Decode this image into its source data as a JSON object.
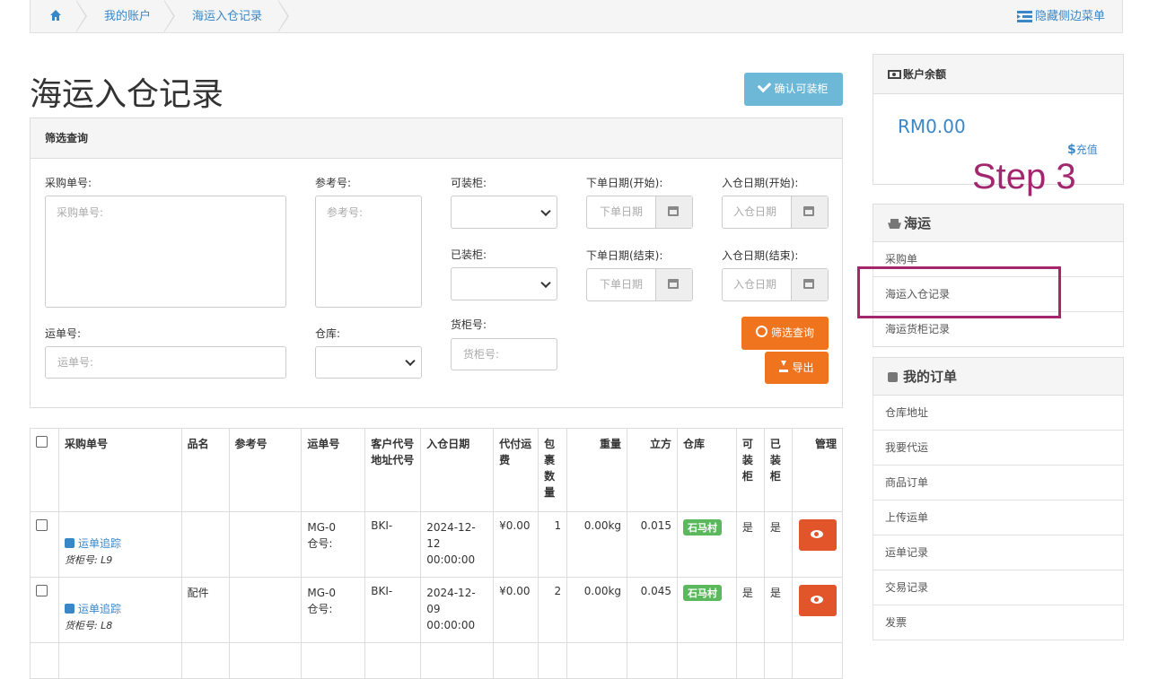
{
  "breadcrumb": {
    "home_icon": "home-icon",
    "items": [
      "我的账户",
      "海运入仓记录"
    ],
    "toggle_label": "隐藏侧边菜单",
    "toggle_icon": "menu-toggle-icon"
  },
  "page": {
    "title": "海运入仓记录",
    "confirm_button": "确认可装柜"
  },
  "filter": {
    "title": "筛选查询",
    "fields": {
      "po_label": "采购单号:",
      "po_placeholder": "采购单号:",
      "ref_label": "参考号:",
      "ref_placeholder": "参考号:",
      "loadable_label": "可装柜:",
      "loaded_label": "已装柜:",
      "order_start_label": "下单日期(开始):",
      "order_start_placeholder": "下单日期",
      "order_end_label": "下单日期(结束):",
      "order_end_placeholder": "下单日期",
      "in_start_label": "入仓日期(开始):",
      "in_start_placeholder": "入仓日期",
      "in_end_label": "入仓日期(结束):",
      "in_end_placeholder": "入仓日期",
      "waybill_label": "运单号:",
      "waybill_placeholder": "运单号:",
      "warehouse_label": "仓库:",
      "container_label": "货柜号:",
      "container_placeholder": "货柜号:"
    },
    "search_button": "筛选查询",
    "export_button": "导出"
  },
  "table": {
    "headers": [
      "采购单号",
      "品名",
      "参考号",
      "运单号",
      "客户代号\n地址代号",
      "入仓日期",
      "代付运费",
      "包裹数量",
      "重量",
      "立方",
      "仓库",
      "可装柜",
      "已装柜",
      "管理"
    ],
    "rows": [
      {
        "track": "运单追踪",
        "container": "货柜号:  L9",
        "name": "",
        "ref": "",
        "waybill": "MG-0\n仓号:",
        "customer": "BKI-",
        "date": "2024-12-12\n00:00:00",
        "freight": "¥0.00",
        "packages": "1",
        "weight": "0.00kg",
        "volume": "0.015",
        "warehouse": "石马村",
        "loadable": "是",
        "loaded": "是"
      },
      {
        "track": "运单追踪",
        "container": "货柜号:  L8",
        "name": "配件",
        "ref": "",
        "waybill": "MG-0\n仓号:",
        "customer": "BKI-",
        "date": "2024-12-09\n00:00:00",
        "freight": "¥0.00",
        "packages": "2",
        "weight": "0.00kg",
        "volume": "0.045",
        "warehouse": "石马村",
        "loadable": "是",
        "loaded": "是"
      }
    ]
  },
  "sidebar": {
    "balance_title": "账户余额",
    "balance_value": "RM0.00",
    "recharge": "充值",
    "annotation": "Step 3",
    "sea_title": "海运",
    "sea_items": [
      "采购单",
      "海运入仓记录",
      "海运货柜记录"
    ],
    "orders_title": "我的订单",
    "order_items": [
      "仓库地址",
      "我要代运",
      "商品订单",
      "上传运单",
      "运单记录",
      "交易记录",
      "发票"
    ]
  },
  "colors": {
    "link": "#3a87c8",
    "orange": "#f0741e",
    "confirm": "#6cb8d6",
    "annotation": "#a3276f",
    "green": "#5cb85c",
    "eye": "#e2552b"
  }
}
